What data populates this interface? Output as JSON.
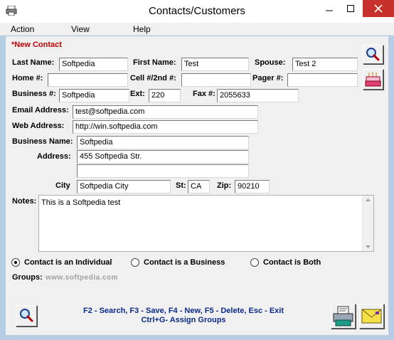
{
  "window": {
    "title": "Contacts/Customers",
    "icons": {
      "app": "printer-icon",
      "minimize": "minimize-icon",
      "maximize": "maximize-icon",
      "close": "close-icon"
    }
  },
  "menu": {
    "items": [
      "Action",
      "View",
      "Help"
    ]
  },
  "form": {
    "status": "*New Contact",
    "last_name": {
      "label": "Last Name:",
      "value": "Softpedia"
    },
    "first_name": {
      "label": "First Name:",
      "value": "Test"
    },
    "spouse": {
      "label": "Spouse:",
      "value": "Test 2"
    },
    "home": {
      "label": "Home #:",
      "value": ""
    },
    "cell": {
      "label": "Cell #/2nd #:",
      "value": ""
    },
    "pager": {
      "label": "Pager #:",
      "value": ""
    },
    "business_phone": {
      "label": "Business #:",
      "value": "Softpedia"
    },
    "ext": {
      "label": "Ext:",
      "value": "220"
    },
    "fax": {
      "label": "Fax #:",
      "value": "2055633"
    },
    "email": {
      "label": "Email Address:",
      "value": "test@softpedia.com"
    },
    "web": {
      "label": "Web Address:",
      "value": "http://win.softpedia.com"
    },
    "business_name": {
      "label": "Business Name:",
      "value": "Softpedia"
    },
    "address": {
      "label": "Address:",
      "line1": "455 Softpedia Str.",
      "line2": ""
    },
    "city": {
      "label": "City",
      "value": "Softpedia City"
    },
    "state": {
      "label": "St:",
      "value": "CA"
    },
    "zip": {
      "label": "Zip:",
      "value": "90210"
    },
    "notes": {
      "label": "Notes:",
      "value": "This is a Softpedia test"
    },
    "contact_type": {
      "options": [
        "Contact is an Individual",
        "Contact is a Business",
        "Contact is Both"
      ],
      "selected": "Contact is an Individual"
    },
    "groups": {
      "label": "Groups:",
      "watermark": "www.softpedia.com"
    }
  },
  "shortcuts": {
    "line1": "F2 - Search,  F3 - Save,  F4 - New,  F5 - Delete,  Esc - Exit",
    "line2": "Ctrl+G- Assign Groups"
  },
  "icons": {
    "search_top": "magnifier-icon",
    "birthday": "cake-icon",
    "search_bottom": "magnifier-icon",
    "print": "printer-icon",
    "mail": "envelope-icon"
  },
  "colors": {
    "accent": "#0a2a8c",
    "status": "#c00000",
    "frame": "#b7cde4",
    "close": "#c7302b"
  }
}
